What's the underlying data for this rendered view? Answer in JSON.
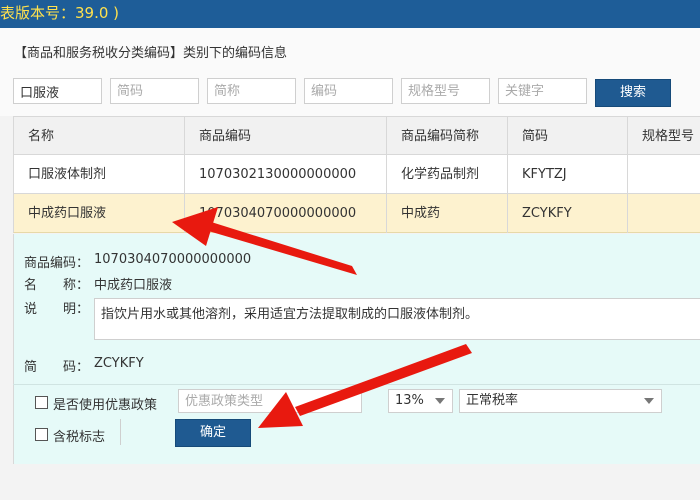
{
  "title": "表版本号：39.0 )",
  "section_title": "【商品和服务税收分类编码】类别下的编码信息",
  "search": {
    "name_value": "口服液",
    "placeholders": [
      "简码",
      "简称",
      "编码",
      "规格型号",
      "关键字"
    ],
    "button_label": "搜索"
  },
  "table": {
    "headers": [
      "名称",
      "商品编码",
      "商品编码简称",
      "简码",
      "规格型号"
    ],
    "rows": [
      [
        "口服液体制剂",
        "1070302130000000000",
        "化学药品制剂",
        "KFYTZJ",
        ""
      ],
      [
        "中成药口服液",
        "1070304070000000000",
        "中成药",
        "ZCYKFY",
        ""
      ]
    ]
  },
  "detail": {
    "code_label": "商品编码：",
    "code_value": "1070304070000000000",
    "name_label": "名　　称：",
    "name_value": "中成药口服液",
    "desc_label": "说　　明：",
    "desc_value": "指饮片用水或其他溶剂，采用适宜方法提取制成的口服液体制剂。",
    "shortcode_label": "简　　码：",
    "shortcode_value": "ZCYKFY"
  },
  "form": {
    "policy_checkbox_label": "是否使用优惠政策",
    "policy_type_placeholder": "优惠政策类型",
    "tax_rate": "13%",
    "tax_type": "正常税率",
    "tax_incl_label": "含税标志",
    "confirm_label": "确定"
  },
  "colors": {
    "titlebar": "#1e5d98",
    "title_text": "#ffe14d",
    "button": "#1f5a91",
    "selected_row": "#fdf2cf",
    "detail_bg": "#e6faf8",
    "arrow": "#e8190f"
  }
}
